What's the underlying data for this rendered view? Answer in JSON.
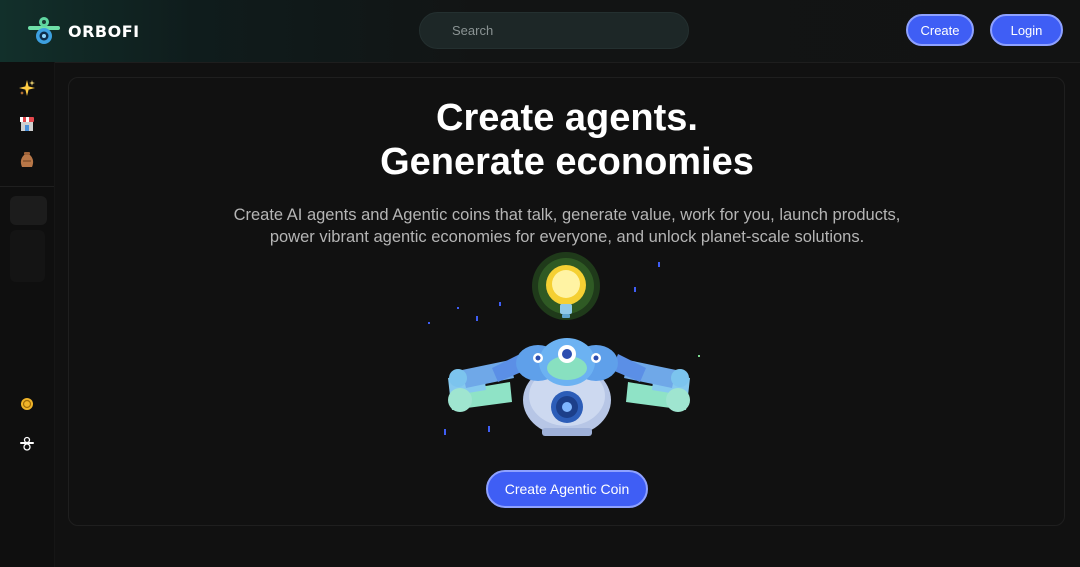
{
  "header": {
    "logo_text": "ORBOFI",
    "search_placeholder": "Search",
    "create_label": "Create",
    "login_label": "Login"
  },
  "sidebar": {
    "items": [
      {
        "icon": "sparkles-icon",
        "glyph": "✨"
      },
      {
        "icon": "store-icon",
        "glyph": "🏪"
      },
      {
        "icon": "vase-icon",
        "glyph": "🏺"
      }
    ],
    "bottom_items": [
      {
        "icon": "coin-icon"
      },
      {
        "icon": "orbofi-bot-icon"
      }
    ]
  },
  "hero": {
    "title_line1": "Create agents.",
    "title_line2": "Generate economies",
    "subtitle_line1": "Create AI agents and Agentic coins that talk, generate value, work for you, launch products,",
    "subtitle_line2": "power vibrant agentic economies for everyone, and unlock planet-scale solutions.",
    "cta_label": "Create Agentic Coin"
  },
  "colors": {
    "accent": "#3f5ef5",
    "accent_border": "#8ea1ff",
    "background": "#111111"
  }
}
